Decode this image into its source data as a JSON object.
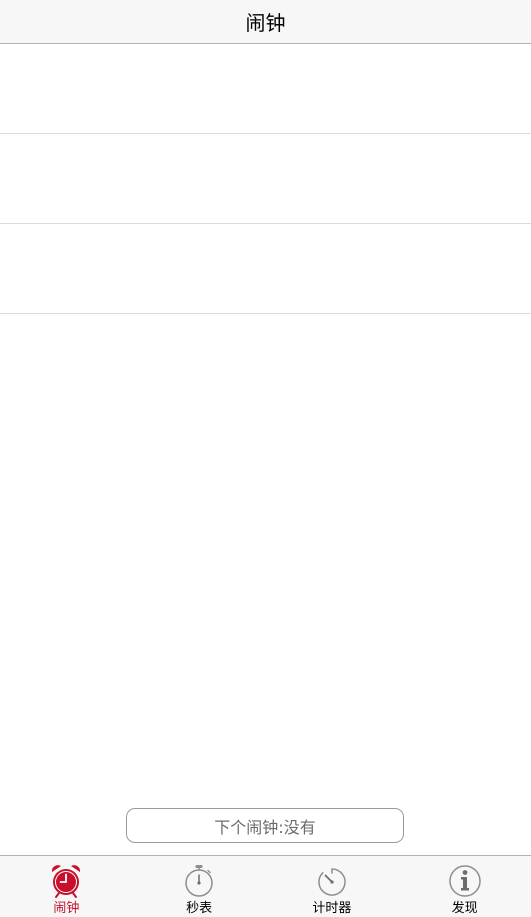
{
  "navbar": {
    "title": "闹钟"
  },
  "alarms": [
    {
      "label": ""
    },
    {
      "label": ""
    },
    {
      "label": ""
    }
  ],
  "next_alarm": {
    "text": "下个闹钟:没有"
  },
  "tabbar": {
    "items": [
      {
        "label": "闹钟",
        "icon": "alarm-clock-icon",
        "active": true
      },
      {
        "label": "秒表",
        "icon": "stopwatch-icon",
        "active": false
      },
      {
        "label": "计时器",
        "icon": "timer-icon",
        "active": false
      },
      {
        "label": "发现",
        "icon": "info-icon",
        "active": false
      }
    ]
  },
  "colors": {
    "accent": "#c8102e",
    "icon_gray": "#8e8e8e",
    "bar_bg": "#f7f7f7",
    "separator": "#dcdcdc"
  }
}
